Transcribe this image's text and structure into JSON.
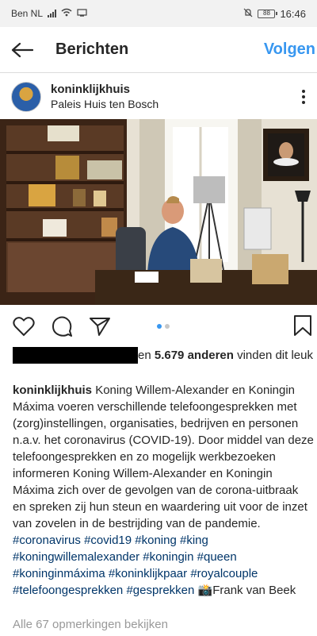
{
  "status_bar": {
    "carrier": "Ben NL",
    "time": "16:46",
    "battery": "88"
  },
  "header": {
    "title": "Berichten",
    "follow_label": "Volgen"
  },
  "post": {
    "username": "koninklijkhuis",
    "location": "Paleis Huis ten Bosch",
    "likes_text": "en",
    "likes_count": "5.679 anderen",
    "likes_suffix": "vinden dit leuk",
    "caption_user": "koninklijkhuis",
    "caption_text": "Koning Willem-Alexander en Koningin Máxima voeren verschillende telefoongesprekken met (zorg)instellingen, organisaties, bedrijven en personen n.a.v. het coronavirus (COVID-19). Door middel van deze telefoongesprekken en zo mogelijk werkbezoeken informeren Koning Willem-Alexander en Koningin Máxima zich over de gevolgen van de corona-uitbraak en spreken zij hun steun en waardering uit voor de inzet van zovelen in de bestrijding van de pandemie.",
    "hashtags": [
      "#coronavirus",
      "#covid19",
      "#koning",
      "#king",
      "#koningwillemalexander",
      "#koningin",
      "#queen",
      "#koninginmáxima",
      "#koninklijkpaar",
      "#royalcouple",
      "#telefoongesprekken",
      "#gesprekken"
    ],
    "photo_credit": "📸Frank van Beek",
    "view_comments": "Alle 67 opmerkingen bekijken"
  },
  "colors": {
    "accent": "#3897f0",
    "text": "#262626",
    "muted": "#999999",
    "hashtag": "#003569"
  }
}
